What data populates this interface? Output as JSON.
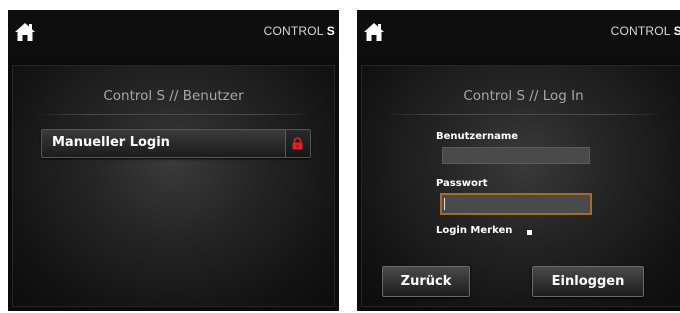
{
  "left_screen": {
    "brand": {
      "text": "CONTROL ",
      "suffix": "S"
    },
    "icons": {
      "home": "home-icon",
      "lock": "lock-icon"
    },
    "panel_title": "Control S // Benutzer",
    "login_option_label": "Manueller Login",
    "lock_color": "#e0202a"
  },
  "right_screen": {
    "brand": {
      "text": "CONTROL ",
      "suffix": "S"
    },
    "icons": {
      "home": "home-icon"
    },
    "panel_title": "Control S // Log In",
    "username_label": "Benutzername",
    "username_value": "",
    "password_label": "Passwort",
    "password_value": "",
    "remember_label": "Login Merken",
    "remember_checked": true,
    "back_button": "Zurück",
    "login_button": "Einloggen",
    "focus_color": "#a86a28"
  }
}
